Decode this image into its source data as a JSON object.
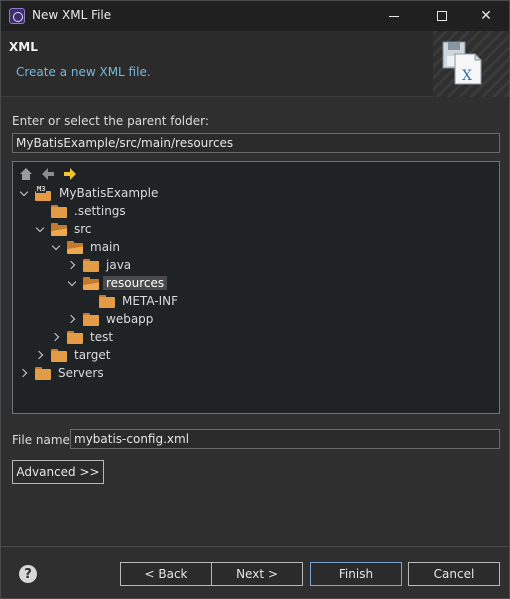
{
  "window": {
    "title": "New XML File"
  },
  "header": {
    "title": "XML",
    "description": "Create a new XML file."
  },
  "folder": {
    "label": "Enter or select the parent folder:",
    "value": "MyBatisExample/src/main/resources"
  },
  "tree": {
    "toolbar": [
      "home-icon",
      "back-arrow-icon",
      "forward-arrow-icon"
    ],
    "nodes": [
      {
        "label": "MyBatisExample",
        "state": "open",
        "type": "project",
        "badge": "M3"
      },
      {
        "label": ".settings",
        "state": "leaf",
        "type": "folder"
      },
      {
        "label": "src",
        "state": "open",
        "type": "folder"
      },
      {
        "label": "main",
        "state": "open",
        "type": "folder"
      },
      {
        "label": "java",
        "state": "closed",
        "type": "folder"
      },
      {
        "label": "resources",
        "state": "open",
        "type": "folder",
        "selected": true
      },
      {
        "label": "META-INF",
        "state": "leaf",
        "type": "folder"
      },
      {
        "label": "webapp",
        "state": "closed",
        "type": "folder"
      },
      {
        "label": "test",
        "state": "closed",
        "type": "folder"
      },
      {
        "label": "target",
        "state": "closed",
        "type": "folder"
      },
      {
        "label": "Servers",
        "state": "closed",
        "type": "folder"
      }
    ]
  },
  "file_name": {
    "label": "File name:",
    "value": "mybatis-config.xml"
  },
  "buttons": {
    "advanced": "Advanced >>",
    "back": "< Back",
    "next": "Next >",
    "finish": "Finish",
    "cancel": "Cancel"
  },
  "colors": {
    "accent": "#76b7d9",
    "folder": "#e39c45",
    "background": "#2f2f2f"
  }
}
